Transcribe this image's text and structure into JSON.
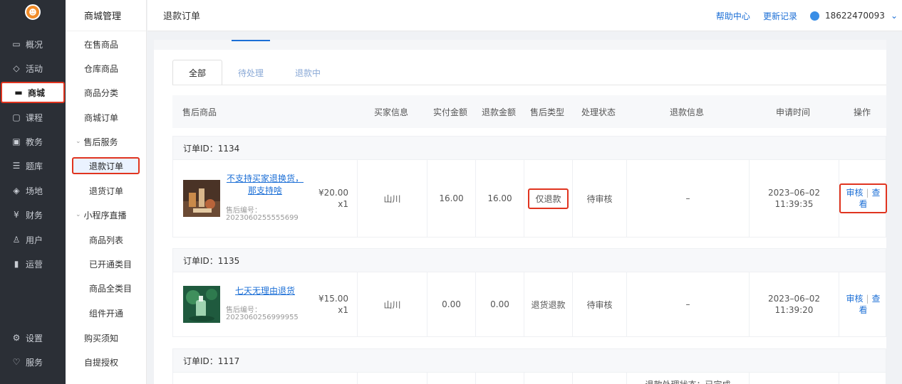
{
  "nav": {
    "items": [
      {
        "icon": "chat-icon",
        "glyph": "▭",
        "label": "概况"
      },
      {
        "icon": "tag-icon",
        "glyph": "◇",
        "label": "活动"
      },
      {
        "icon": "store-icon",
        "glyph": "▬",
        "label": "商城"
      },
      {
        "icon": "course-icon",
        "glyph": "▢",
        "label": "课程"
      },
      {
        "icon": "education-icon",
        "glyph": "▣",
        "label": "教务"
      },
      {
        "icon": "question-bank-icon",
        "glyph": "☰",
        "label": "题库"
      },
      {
        "icon": "venue-icon",
        "glyph": "◈",
        "label": "场地"
      },
      {
        "icon": "finance-icon",
        "glyph": "¥",
        "label": "财务"
      },
      {
        "icon": "user-icon",
        "glyph": "♙",
        "label": "用户"
      },
      {
        "icon": "operations-icon",
        "glyph": "▮",
        "label": "运营"
      },
      {
        "icon": "settings-icon",
        "glyph": "⚙",
        "label": "设置"
      },
      {
        "icon": "service-icon",
        "glyph": "♡",
        "label": "服务"
      }
    ]
  },
  "subnav": {
    "title": "商城管理",
    "items": [
      "在售商品",
      "仓库商品",
      "商品分类",
      "商城订单"
    ],
    "after_sales": "售后服务",
    "after_sales_items": [
      "退款订单",
      "退货订单"
    ],
    "live": "小程序直播",
    "live_items": [
      "商品列表",
      "已开通类目",
      "商品全类目",
      "组件开通"
    ],
    "tail_items": [
      "购买须知",
      "自提授权"
    ]
  },
  "header": {
    "title": "退款订单",
    "help": "帮助中心",
    "changelog": "更新记录",
    "phone": "18622470093"
  },
  "tabs": [
    "全部",
    "待处理",
    "退款中"
  ],
  "table": {
    "headers": [
      "售后商品",
      "买家信息",
      "实付金额",
      "退款金额",
      "售后类型",
      "处理状态",
      "退款信息",
      "申请时间",
      "操作"
    ]
  },
  "orders": [
    {
      "order_label": "订单ID：1134",
      "name": "不支持买家退换货，那支持啥",
      "code_label": "售后编号：",
      "code": "2023060255555699",
      "price": "¥20.00",
      "qty": "x1",
      "buyer": "山川",
      "paid": "16.00",
      "refund": "16.00",
      "type": "仅退款",
      "status": "待审核",
      "info": "–",
      "date": "2023–06–02",
      "time": "11:39:35",
      "op_review": "审核",
      "op_view": "查看"
    },
    {
      "order_label": "订单ID：1135",
      "name": "七天无理由退货",
      "code_label": "售后编号：",
      "code": "2023060256999955",
      "price": "¥15.00",
      "qty": "x1",
      "buyer": "山川",
      "paid": "0.00",
      "refund": "0.00",
      "type": "退货退款",
      "status": "待审核",
      "info": "–",
      "date": "2023–06–02",
      "time": "11:39:20",
      "op_review": "审核",
      "op_view": "查看"
    },
    {
      "order_label": "订单ID：1117",
      "info_partial": "退款处理状态：已完成"
    }
  ],
  "colors": {
    "accent": "#1c6fd6",
    "highlight": "#e0341f",
    "nav_bg": "#2b2f36"
  }
}
